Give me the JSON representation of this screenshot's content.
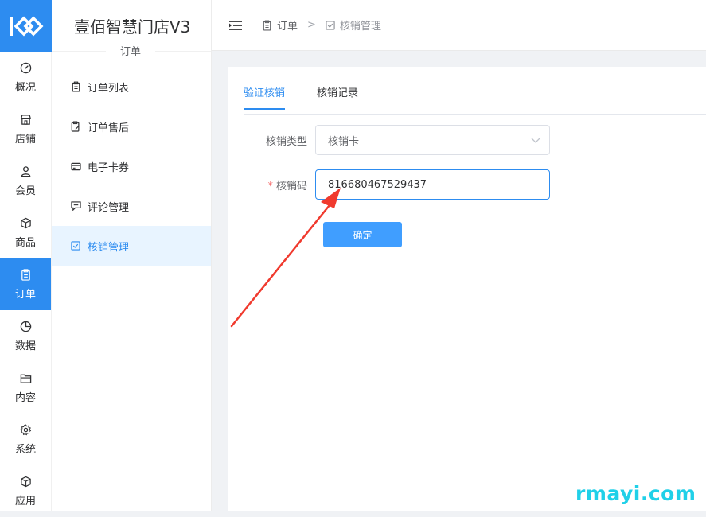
{
  "app": {
    "title": "壹佰智慧门店V3",
    "section_label": "订单"
  },
  "colors": {
    "primary": "#2d8cf0",
    "button": "#409eff",
    "arrow": "#f03a2e",
    "watermark": "#20d0e8"
  },
  "rail": {
    "items": [
      {
        "label": "概况",
        "icon": "dashboard-icon"
      },
      {
        "label": "店铺",
        "icon": "store-icon"
      },
      {
        "label": "会员",
        "icon": "user-icon"
      },
      {
        "label": "商品",
        "icon": "box-icon"
      },
      {
        "label": "订单",
        "icon": "clipboard-icon",
        "active": true
      },
      {
        "label": "数据",
        "icon": "pie-chart-icon"
      },
      {
        "label": "内容",
        "icon": "folder-icon"
      },
      {
        "label": "系统",
        "icon": "gear-icon"
      },
      {
        "label": "应用",
        "icon": "cube-icon"
      }
    ]
  },
  "submenu": {
    "items": [
      {
        "label": "订单列表",
        "icon": "clipboard-icon"
      },
      {
        "label": "订单售后",
        "icon": "clipboard-edit-icon"
      },
      {
        "label": "电子卡券",
        "icon": "card-icon"
      },
      {
        "label": "评论管理",
        "icon": "comment-icon"
      },
      {
        "label": "核销管理",
        "icon": "checkbox-icon",
        "active": true
      }
    ]
  },
  "breadcrumb": {
    "parent": "订单",
    "separator": ">",
    "current": "核销管理"
  },
  "tabs": [
    {
      "label": "验证核销",
      "active": true
    },
    {
      "label": "核销记录"
    }
  ],
  "form": {
    "type_label": "核销类型",
    "type_value": "核销卡",
    "required_mark": "*",
    "code_label": "核销码",
    "code_value": "816680467529437",
    "confirm_label": "确定"
  },
  "watermark": "rmayi.com"
}
